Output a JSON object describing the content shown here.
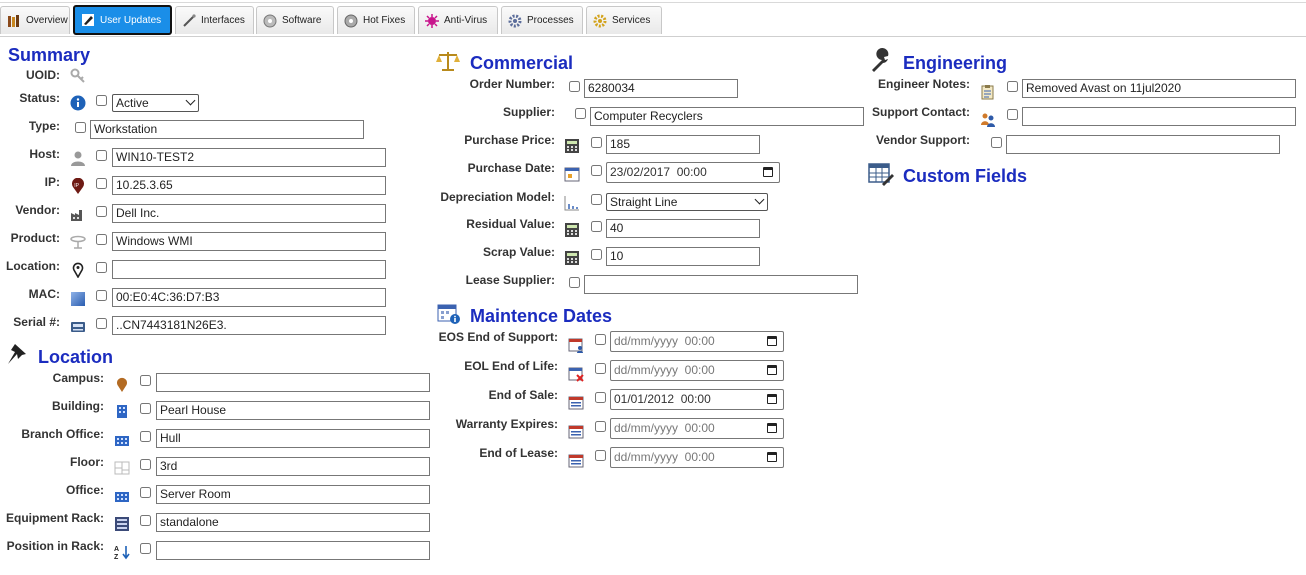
{
  "tabs": [
    {
      "label": "Overview",
      "icon": "books-icon"
    },
    {
      "label": "User Updates",
      "icon": "edit-icon",
      "active": true
    },
    {
      "label": "Interfaces",
      "icon": "cable-icon"
    },
    {
      "label": "Software",
      "icon": "disc-icon"
    },
    {
      "label": "Hot Fixes",
      "icon": "disc-icon"
    },
    {
      "label": "Anti-Virus",
      "icon": "virus-icon"
    },
    {
      "label": "Processes",
      "icon": "gear-icon"
    },
    {
      "label": "Services",
      "icon": "gear-icon"
    }
  ],
  "summary": {
    "title": "Summary",
    "uoid_label": "UOID:",
    "status_label": "Status:",
    "status_value": "Active",
    "type_label": "Type:",
    "type_value": "Workstation",
    "host_label": "Host:",
    "host_value": "WIN10-TEST2",
    "ip_label": "IP:",
    "ip_value": "10.25.3.65",
    "vendor_label": "Vendor:",
    "vendor_value": "Dell Inc.",
    "product_label": "Product:",
    "product_value": "Windows WMI",
    "location_label": "Location:",
    "location_value": "",
    "mac_label": "MAC:",
    "mac_value": "00:E0:4C:36:D7:B3",
    "serial_label": "Serial #:",
    "serial_value": "..CN7443181N26E3."
  },
  "location": {
    "title": "Location",
    "campus_label": "Campus:",
    "campus_value": "",
    "building_label": "Building:",
    "building_value": "Pearl House",
    "branch_label": "Branch Office:",
    "branch_value": "Hull",
    "floor_label": "Floor:",
    "floor_value": "3rd",
    "office_label": "Office:",
    "office_value": "Server Room",
    "rack_label": "Equipment Rack:",
    "rack_value": "standalone",
    "position_label": "Position in Rack:",
    "position_value": ""
  },
  "commercial": {
    "title": "Commercial",
    "order_label": "Order Number:",
    "order_value": "6280034",
    "supplier_label": "Supplier:",
    "supplier_value": "Computer Recyclers",
    "price_label": "Purchase Price:",
    "price_value": "185",
    "date_label": "Purchase Date:",
    "date_value": "23/02/2017  00:00",
    "depr_label": "Depreciation Model:",
    "depr_value": "Straight Line",
    "residual_label": "Residual Value:",
    "residual_value": "40",
    "scrap_label": "Scrap Value:",
    "scrap_value": "10",
    "lease_label": "Lease Supplier:",
    "lease_value": ""
  },
  "maintenance": {
    "title": "Maintence Dates",
    "eos_label": "EOS End of Support:",
    "eos_value": "dd/mm/yyyy  00:00",
    "eol_label": "EOL End of Life:",
    "eol_value": "dd/mm/yyyy  00:00",
    "eosale_label": "End of Sale:",
    "eosale_value": "01/01/2012  00:00",
    "warranty_label": "Warranty Expires:",
    "warranty_value": "dd/mm/yyyy  00:00",
    "eolease_label": "End of Lease:",
    "eolease_value": "dd/mm/yyyy  00:00"
  },
  "engineering": {
    "title": "Engineering",
    "notes_label": "Engineer Notes:",
    "notes_value": "Removed Avast on 11jul2020",
    "contact_label": "Support Contact:",
    "contact_value": "",
    "vendor_label": "Vendor Support:",
    "vendor_value": ""
  },
  "custom_fields": {
    "title": "Custom Fields"
  },
  "colors": {
    "heading": "#1b2cbf",
    "active_tab": "#1a8ee8"
  }
}
